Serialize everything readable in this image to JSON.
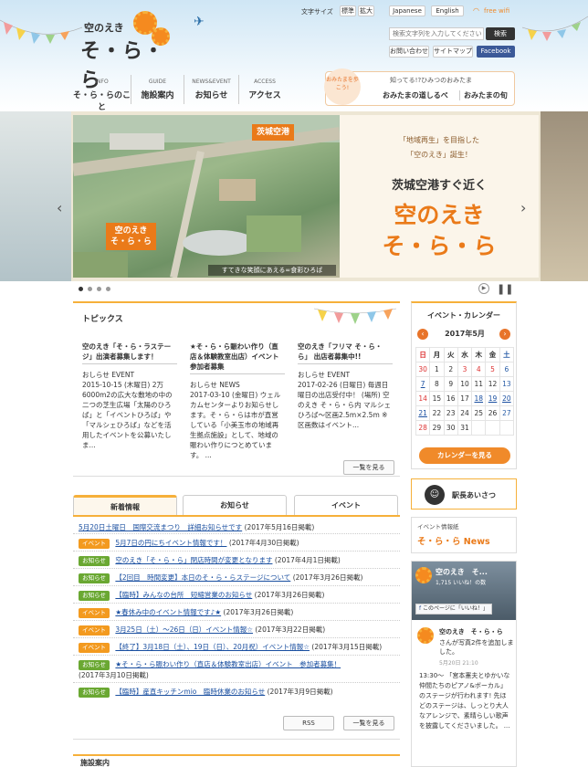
{
  "header": {
    "logo_small": "空のえき",
    "logo_big": "そ・ら・ら",
    "font_size_label": "文字サイズ",
    "font_standard": "標準",
    "font_large": "拡大",
    "lang_japanese": "Japanese",
    "lang_english": "English",
    "free_wifi": "free wifi",
    "search_placeholder": "検索文字列を入力してください",
    "search_button": "検索",
    "contact": "お問い合わせ",
    "sitemap": "サイトマップ",
    "facebook": "Facebook"
  },
  "nav": [
    {
      "en": "INFO",
      "ja": "そ・ら・らのこと"
    },
    {
      "en": "GUIDE",
      "ja": "施設案内"
    },
    {
      "en": "NEWS&EVENT",
      "ja": "お知らせ"
    },
    {
      "en": "ACCESS",
      "ja": "アクセス"
    }
  ],
  "omitama": {
    "badge": "おみたまを歩こう!",
    "heading": "知ってる!?ひみつのおみたま",
    "link1": "おみたまの道しるべ",
    "link2": "おみたまの旬"
  },
  "hero": {
    "tag_airport": "茨城空港",
    "tag_sorara_1": "空のえき",
    "tag_sorara_2": "そ・ら・ら",
    "caption": "すてきな笑顔にあえる∞食彩ひろば",
    "line1": "「地域再生」を目指した",
    "line2": "「空のえき」誕生！",
    "subtitle": "茨城空港すぐ近く",
    "title1": "空のえき",
    "title2": "そ・ら・ら"
  },
  "topics": {
    "title": "トピックス",
    "items": [
      {
        "title": "空のえき「そ・ら・ラステージ」出演者募集します！",
        "category": "おしらせ EVENT",
        "text": "2015-10-15 (木曜日) 2万6000m2の広大な敷地の中の二つの芝生広場「太陽のひろば」と「イベントひろば」や「マルシェひろば」などを活用したイベントを公募いたしま..."
      },
      {
        "title": "★そ・ら・ら賑わい作り（直店＆体験教室出店）イベント 参加者募集",
        "category": "おしらせ NEWS",
        "text": "2017-03-10 (金曜日) ウェルカムセンターよりお知らせします。そ・ら・らは市が直営している「小美玉市の地域再生拠点施設」として、地域の賑わい作りにつとめています。 ..."
      },
      {
        "title": "空のえき「フリマ そ・ら・ら」 出店者募集中!!",
        "category": "おしらせ EVENT",
        "text": "2017-02-26 (日曜日) 毎週日曜日の出店受付中！ (場所) 空のえき そ・ら・ら内 マルシェひろば～区画2.5m×2.5m ※区画数はイベント..."
      }
    ],
    "more": "一覧を見る"
  },
  "news": {
    "tabs": [
      "新着情報",
      "お知らせ",
      "イベント"
    ],
    "tag_event": "イベント",
    "tag_notice": "お知らせ",
    "rows": [
      {
        "tag": "",
        "title": "5月20日土曜日　国際交流まつり　詳細お知らせです",
        "date": "(2017年5月16日掲載)"
      },
      {
        "tag": "event",
        "title": "5月7日の円にちイベント情報です！",
        "date": "(2017年4月30日掲載)"
      },
      {
        "tag": "notice",
        "title": "空のえき「そ・ら・ら」閉店時間が変更となります",
        "date": "(2017年4月1日掲載)"
      },
      {
        "tag": "notice",
        "title": "【2回目　時間変更】本日のそ・ら・らステージについて",
        "date": "(2017年3月26日掲載)"
      },
      {
        "tag": "notice",
        "title": "【臨時】みんなの台所　短縮営業のお知らせ",
        "date": "(2017年3月26日掲載)"
      },
      {
        "tag": "event",
        "title": "★春休み中のイベント情報です♪★",
        "date": "(2017年3月26日掲載)"
      },
      {
        "tag": "event",
        "title": "3月25日（土）～26日（日）イベント情報☆",
        "date": "(2017年3月22日掲載)"
      },
      {
        "tag": "event",
        "title": "【終了】3月18日（土）、19日（日）、20月祝）イベント情報☆",
        "date": "(2017年3月15日掲載)"
      },
      {
        "tag": "notice",
        "title": "★そ・ら・ら賑わい作り（直店＆体験教室出店）イベント　参加者募集！",
        "date": "(2017年3月10日掲載)"
      },
      {
        "tag": "notice",
        "title": "【臨時】産直キッチンmio　臨時休業のお知らせ",
        "date": "(2017年3月9日掲載)"
      }
    ],
    "rss": "RSS",
    "more": "一覧を見る"
  },
  "calendar": {
    "title": "イベント・カレンダー",
    "month": "2017年5月",
    "weekdays": [
      "日",
      "月",
      "火",
      "水",
      "木",
      "金",
      "土"
    ],
    "weeks": [
      [
        "",
        "1",
        "2",
        "3",
        "4",
        "5",
        "6"
      ],
      [
        "7",
        "8",
        "9",
        "10",
        "11",
        "12",
        "13"
      ],
      [
        "14",
        "15",
        "16",
        "17",
        "18",
        "19",
        "20"
      ],
      [
        "21",
        "22",
        "23",
        "24",
        "25",
        "26",
        "27"
      ],
      [
        "28",
        "29",
        "30",
        "31",
        "",
        "",
        ""
      ]
    ],
    "prev_prefix": "30",
    "button": "カレンダーを見る"
  },
  "sidebar": {
    "stationmaster": "駅長あいさつ",
    "news_small": "イベント情報紙",
    "news_big": "そ・ら・ら News"
  },
  "facebook": {
    "page_name": "空のえき　そ...",
    "likes": "1,715 いいね！の数",
    "like_button": "このページに「いいね！」",
    "post_author": "空のえき　そ・ら・ら",
    "post_meta": "さんが写真2件を追加しました。",
    "post_date": "5月20日 21:10",
    "post_text": "13:30～ 「宮本憲夫とゆかいな仲間たちのピアノ&ボーカル」のステージが行われます! 先ほどのステージは、しっとり大人なアレンジで、素晴らしい歌声を披露してくださいました。 ..."
  },
  "facility": {
    "title": "施設案内"
  },
  "colors": {
    "accent": "#f6b03a",
    "orange": "#ea7a19",
    "link": "#1a4fa0",
    "notice_green": "#6aa832"
  }
}
